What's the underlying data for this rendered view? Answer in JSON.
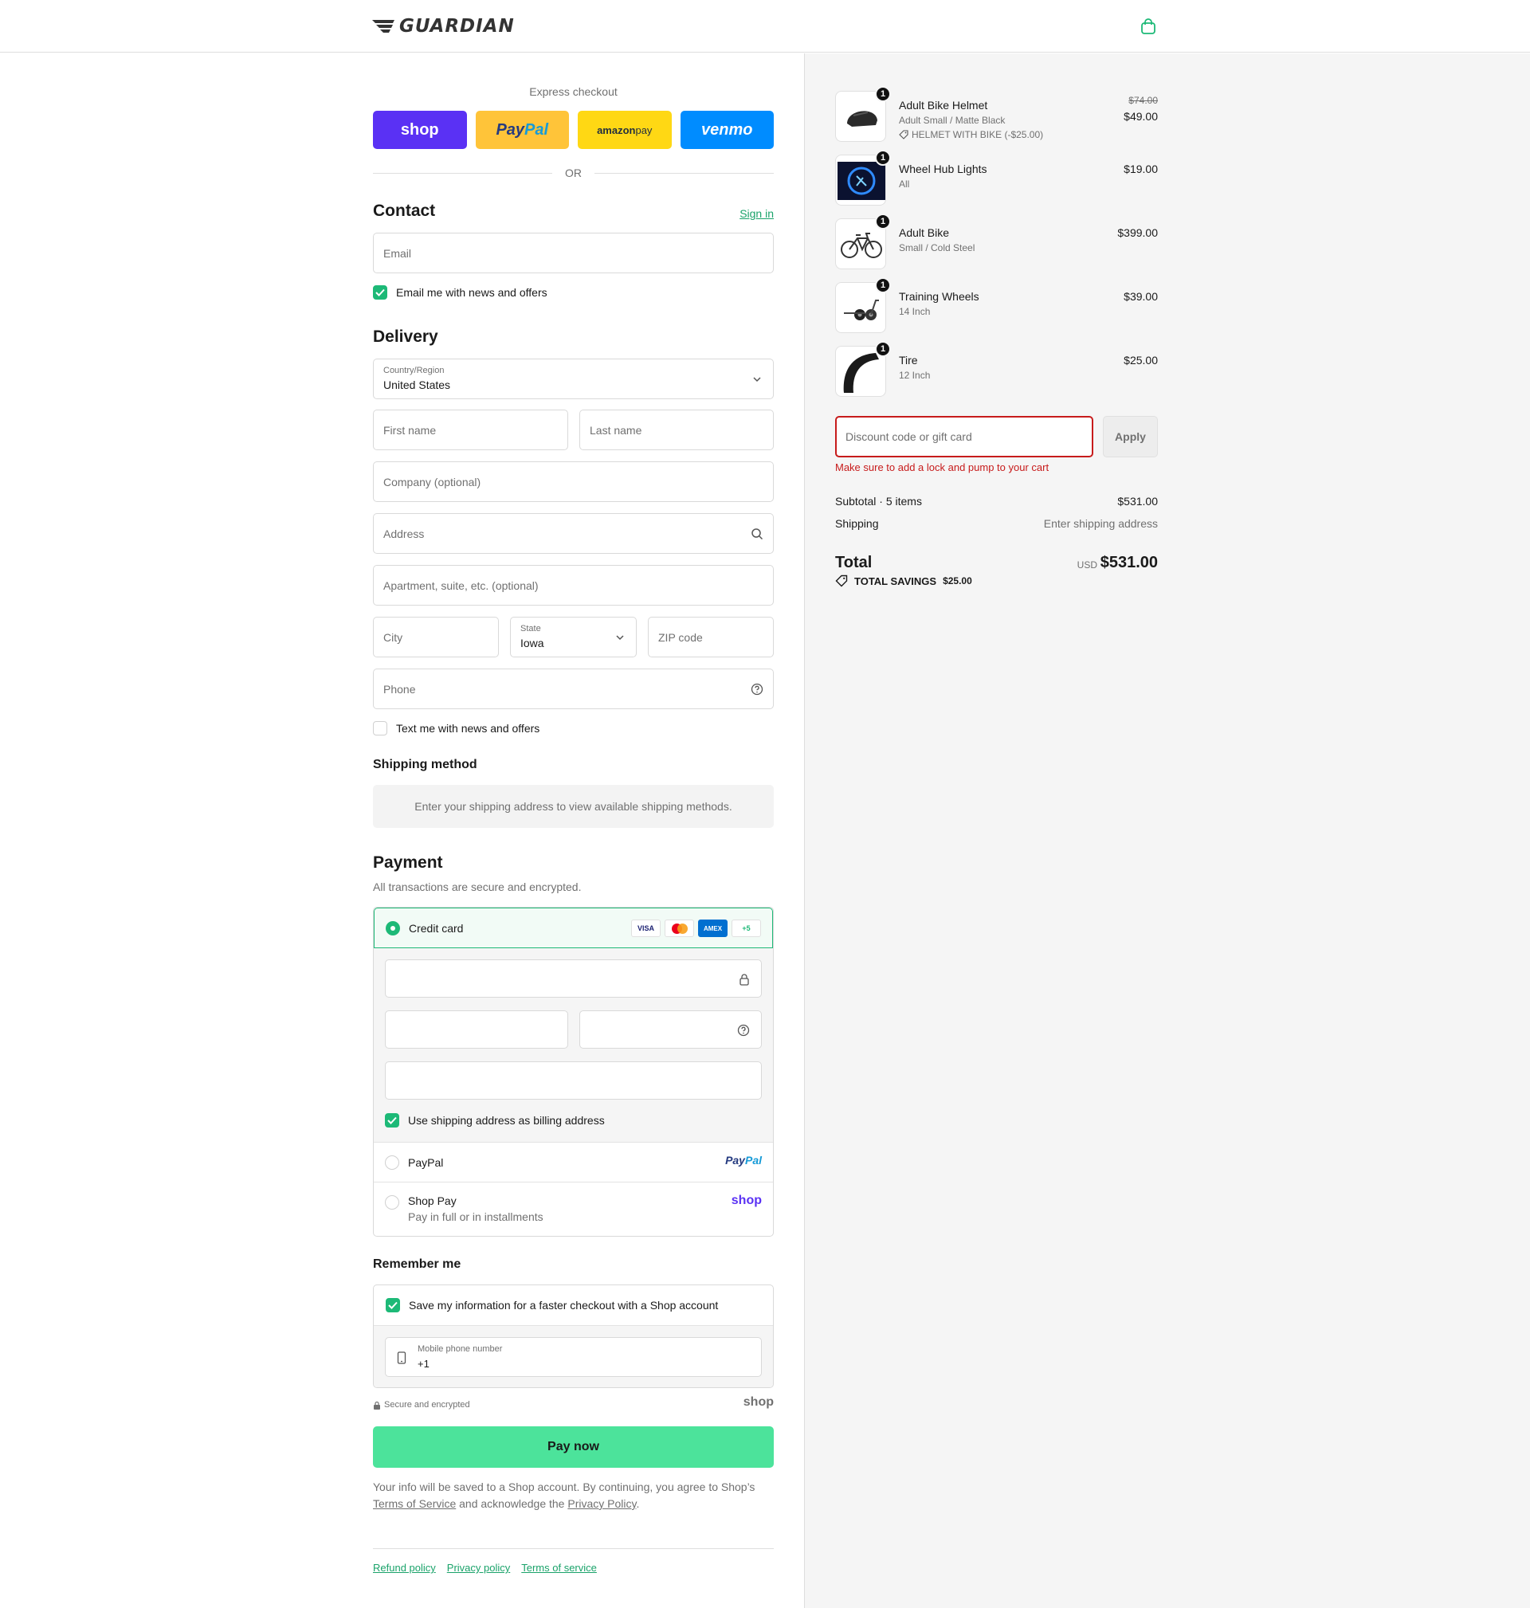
{
  "header": {
    "brand": "GUARDIAN"
  },
  "express": {
    "title": "Express checkout",
    "shop": "shop",
    "paypal_a": "Pay",
    "paypal_b": "Pal",
    "amazon_a": "amazon",
    "amazon_b": " pay",
    "venmo": "venmo",
    "or": "OR"
  },
  "contact": {
    "title": "Contact",
    "sign_in": "Sign in",
    "email_placeholder": "Email",
    "news_label": "Email me with news and offers"
  },
  "delivery": {
    "title": "Delivery",
    "country_label": "Country/Region",
    "country_value": "United States",
    "first_name": "First name",
    "last_name": "Last name",
    "company": "Company (optional)",
    "address": "Address",
    "apartment": "Apartment, suite, etc. (optional)",
    "city": "City",
    "state_label": "State",
    "state_value": "Iowa",
    "zip": "ZIP code",
    "phone": "Phone",
    "text_label": "Text me with news and offers"
  },
  "shipping_method": {
    "title": "Shipping method",
    "message": "Enter your shipping address to view available shipping methods."
  },
  "payment": {
    "title": "Payment",
    "subtitle": "All transactions are secure and encrypted.",
    "credit_card": "Credit card",
    "card_logos": [
      "VISA",
      "",
      "AMEX",
      "+5"
    ],
    "billing_label": "Use shipping address as billing address",
    "paypal": "PayPal",
    "paypal_logo_a": "Pay",
    "paypal_logo_b": "Pal",
    "shop_pay": "Shop Pay",
    "shop_pay_sub": "Pay in full or in installments",
    "shop_logo": "shop"
  },
  "remember": {
    "title": "Remember me",
    "save_label": "Save my information for a faster checkout with a Shop account",
    "mobile_label": "Mobile phone number",
    "mobile_value": "+1",
    "secure": "Secure and encrypted",
    "shop_logo": "shop"
  },
  "pay_now": "Pay now",
  "legal": {
    "text1": "Your info will be saved to a Shop account. By continuing, you agree to Shop’s ",
    "terms": "Terms of Service",
    "text2": " and acknowledge the ",
    "privacy": "Privacy Policy",
    "text3": "."
  },
  "footer": [
    "Refund policy",
    "Privacy policy",
    "Terms of service"
  ],
  "cart": {
    "items": [
      {
        "name": "Adult Bike Helmet",
        "variant": "Adult Small / Matte Black",
        "discount": "HELMET WITH BIKE (-$25.00)",
        "original": "$74.00",
        "price": "$49.00",
        "qty": "1"
      },
      {
        "name": "Wheel Hub Lights",
        "variant": "All",
        "price": "$19.00",
        "qty": "1"
      },
      {
        "name": "Adult Bike",
        "variant": "Small / Cold Steel",
        "price": "$399.00",
        "qty": "1"
      },
      {
        "name": "Training Wheels",
        "variant": "14 Inch",
        "price": "$39.00",
        "qty": "1"
      },
      {
        "name": "Tire",
        "variant": "12 Inch",
        "price": "$25.00",
        "qty": "1"
      }
    ],
    "discount_placeholder": "Discount code or gift card",
    "apply": "Apply",
    "error": "Make sure to add a lock and pump to your cart",
    "subtotal_label": "Subtotal · 5 items",
    "subtotal": "$531.00",
    "shipping_label": "Shipping",
    "shipping_value": "Enter shipping address",
    "total_label": "Total",
    "currency": "USD",
    "total": "$531.00",
    "savings_label": "TOTAL SAVINGS",
    "savings": "$25.00"
  },
  "colors": {
    "accent": "#1db977",
    "pay_button": "#4ce39b",
    "error": "#c71b1b",
    "shop_purple": "#5a31f4"
  }
}
